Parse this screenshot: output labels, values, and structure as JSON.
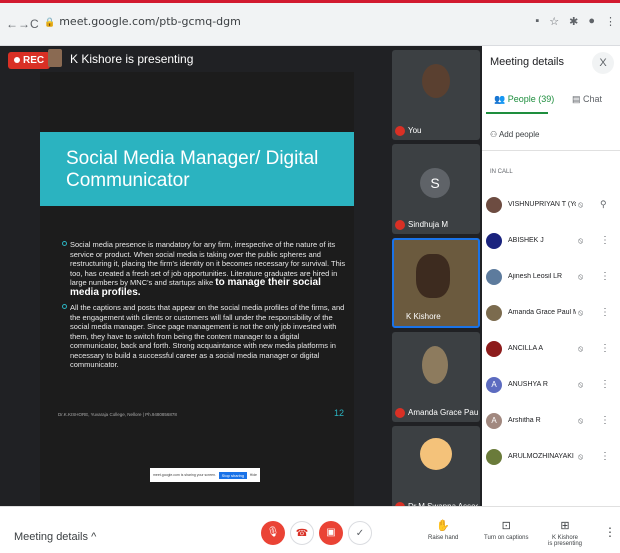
{
  "browser": {
    "url": "meet.google.com/ptb-gcmq-dgm",
    "back": "←",
    "forward": "→",
    "reload": "C"
  },
  "meeting": {
    "rec_label": "REC",
    "presenter_title": "K Kishore is presenting"
  },
  "slide": {
    "title_line1": "Social Media Manager/ Digital",
    "title_line2": "Communicator",
    "para1": "Social media presence is mandatory for any firm, irrespective of the nature of its service or product. When social media is taking over the public spheres and restructuring it, placing the firm's identity on it becomes necessary for survival. This too, has created a fresh set of job opportunities. Literature graduates are hired in large numbers by MNC's and startups alike",
    "para1_strong": "to manage their social media profiles.",
    "para2": "All the captions and posts that appear on the social media profiles of the firms, and the engagement with clients or customers will fall under the responsibility of the social media manager. Since page management is not the only job invested with them, they have to switch from being the content manager to a digital communicator, back and forth. Strong acquaintance with new media platforms in necessary to build a successful career as a social media manager or digital communicator.",
    "number": "12",
    "footer": "Dr.K.KISHORE, Yuvaraja College, Nellore | Ph.9480856878",
    "share_text": "meet.google.com is sharing your screen.",
    "share_stop": "Stop sharing",
    "share_hide": "Hide"
  },
  "tiles": [
    {
      "name": "You"
    },
    {
      "name": "Sindhuja M",
      "letter": "S"
    },
    {
      "name": "K Kishore"
    },
    {
      "name": "Amanda Grace Paul Man..."
    },
    {
      "name": "Dr.M.Swapna Associate ..."
    }
  ],
  "panel": {
    "title": "Meeting details",
    "close": "X",
    "tab_people": "People (39)",
    "tab_chat": "Chat",
    "add_people": "Add people",
    "in_call": "IN CALL",
    "participants": [
      {
        "name": "VISHNUPRIYAN T (You)",
        "letter": "",
        "color": "#6d4c41"
      },
      {
        "name": "ABISHEK J",
        "letter": "",
        "color": "#1a237e"
      },
      {
        "name": "Ajinesh Leosil LR",
        "letter": "",
        "color": "#5d7b9d"
      },
      {
        "name": "Amanda Grace Paul Ma...",
        "letter": "",
        "color": "#7b6b4e"
      },
      {
        "name": "ANCILLA A",
        "letter": "",
        "color": "#8d1c1c"
      },
      {
        "name": "ANUSHYA R",
        "letter": "A",
        "color": "#5c6bc0"
      },
      {
        "name": "Arshitha R",
        "letter": "A",
        "color": "#a1887f"
      },
      {
        "name": "ARULMOZHINAYAKI E",
        "letter": "",
        "color": "#6a7b3a"
      }
    ]
  },
  "bottom": {
    "meeting_details": "Meeting details",
    "raise_hand": "Raise hand",
    "captions": "Turn on captions",
    "presenting_line1": "K Kishore",
    "presenting_line2": "is presenting"
  },
  "colors": {
    "accent_red": "#ea4335",
    "people_green": "#1e8e3e",
    "slide_teal": "#2bb3c0"
  }
}
